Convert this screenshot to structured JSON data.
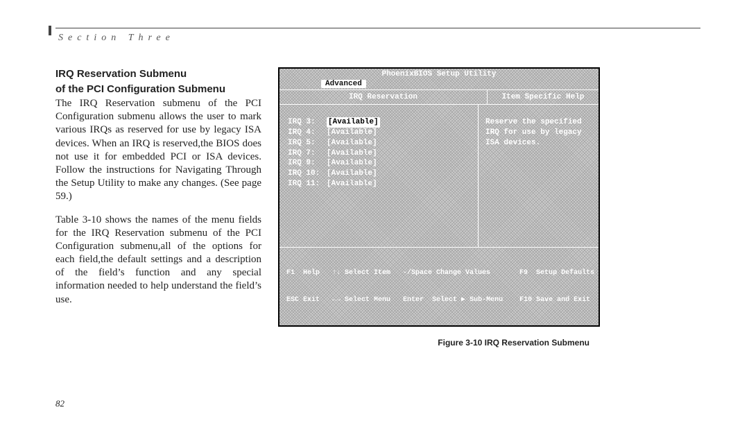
{
  "header": {
    "section": "Section Three"
  },
  "heading": {
    "line1": "IRQ Reservation Submenu",
    "line2": "of the PCI Configuration Submenu"
  },
  "para1": "The IRQ Reservation submenu of the PCI Configuration submenu allows the user to mark various IRQs as reserved for use by legacy ISA devices. When an IRQ is reserved,the BIOS does not use it for embedded PCI or ISA devices. Follow the instructions for Navigating Through the Setup Utility to make any changes. (See page 59.)",
  "para2": "Table 3-10 shows the names of the menu fields for the IRQ Reservation submenu of the PCI Configuration submenu,all of the options for each field,the default settings and a description of the field’s function and any special information needed to help understand the field’s use.",
  "bios": {
    "title": "PhoenixBIOS Setup Utility",
    "tab": "Advanced",
    "col1": "IRQ Reservation",
    "col2": "Item Specific Help",
    "irqs": [
      {
        "label": "IRQ 3:",
        "value": "[Available]",
        "selected": true
      },
      {
        "label": "IRQ 4:",
        "value": "[Available]",
        "selected": false
      },
      {
        "label": "IRQ 5:",
        "value": "[Available]",
        "selected": false
      },
      {
        "label": "IRQ 7:",
        "value": "[Available]",
        "selected": false
      },
      {
        "label": "IRQ 9:",
        "value": "[Available]",
        "selected": false
      },
      {
        "label": "IRQ 10:",
        "value": "[Available]",
        "selected": false
      },
      {
        "label": "IRQ 11:",
        "value": "[Available]",
        "selected": false
      }
    ],
    "help": "Reserve the specified IRQ for use by legacy ISA devices.",
    "footer1": "F1  Help   ↑↓ Select Item   -/Space Change Values       F9  Setup Defaults",
    "footer2": "ESC Exit   ←→ Select Menu   Enter  Select ▶ Sub-Menu    F10 Save and Exit"
  },
  "caption": "Figure 3-10 IRQ Reservation Submenu",
  "page": "82"
}
